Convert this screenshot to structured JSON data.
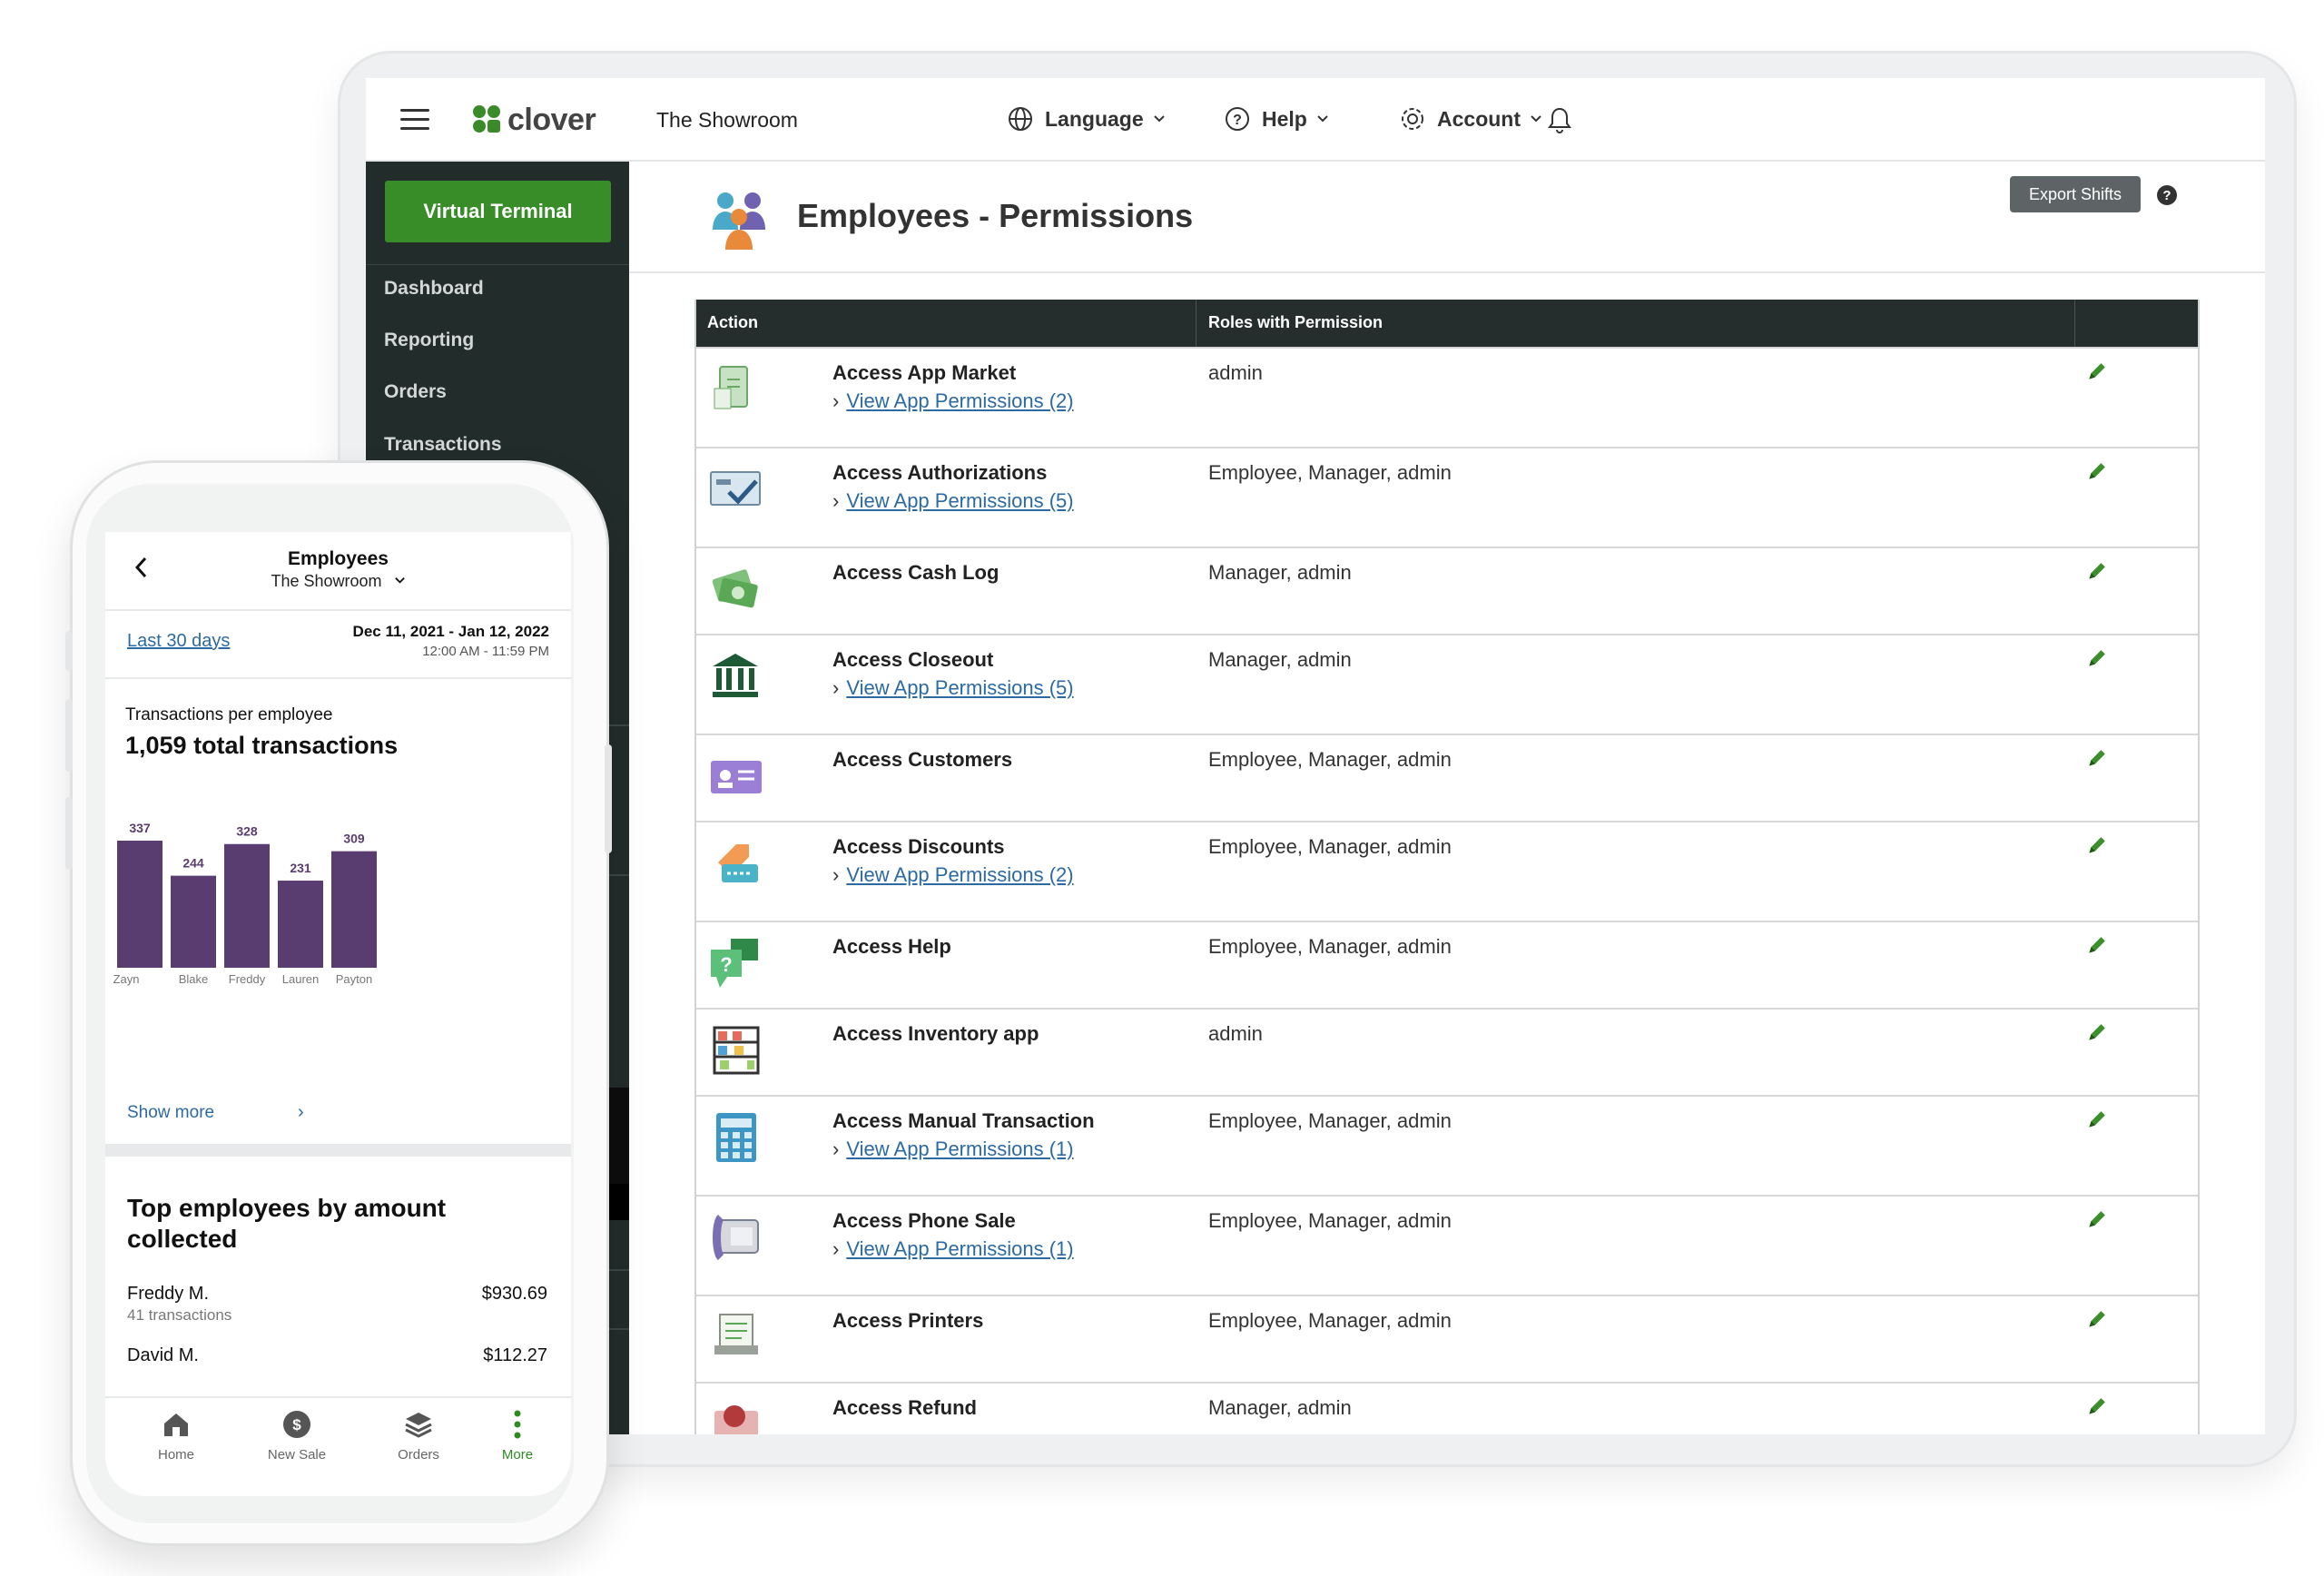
{
  "topbar": {
    "logo_text": "clover",
    "merchant": "The Showroom",
    "language": "Language",
    "help": "Help",
    "account": "Account"
  },
  "sidebar": {
    "virtual_terminal": "Virtual Terminal",
    "items": [
      "Dashboard",
      "Reporting",
      "Orders",
      "Transactions"
    ]
  },
  "page": {
    "title": "Employees - Permissions",
    "export_label": "Export Shifts",
    "help_glyph": "?"
  },
  "table": {
    "col_action": "Action",
    "col_roles": "Roles with Permission",
    "rows": [
      {
        "action": "Access App Market",
        "link": "View App Permissions (2)",
        "roles": "admin",
        "icon": "app-market-icon"
      },
      {
        "action": "Access Authorizations",
        "link": "View App Permissions (5)",
        "roles": "Employee, Manager, admin",
        "icon": "authorizations-icon"
      },
      {
        "action": "Access Cash Log",
        "link": "",
        "roles": "Manager, admin",
        "icon": "cash-icon"
      },
      {
        "action": "Access Closeout",
        "link": "View App Permissions (5)",
        "roles": "Manager, admin",
        "icon": "bank-icon"
      },
      {
        "action": "Access Customers",
        "link": "",
        "roles": "Employee, Manager, admin",
        "icon": "customer-card-icon"
      },
      {
        "action": "Access Discounts",
        "link": "View App Permissions (2)",
        "roles": "Employee, Manager, admin",
        "icon": "discount-icon"
      },
      {
        "action": "Access Help",
        "link": "",
        "roles": "Employee, Manager, admin",
        "icon": "help-chat-icon"
      },
      {
        "action": "Access Inventory app",
        "link": "",
        "roles": "admin",
        "icon": "inventory-shelf-icon"
      },
      {
        "action": "Access Manual Transaction",
        "link": "View App Permissions (1)",
        "roles": "Employee, Manager, admin",
        "icon": "calculator-icon"
      },
      {
        "action": "Access Phone Sale",
        "link": "View App Permissions (1)",
        "roles": "Employee, Manager, admin",
        "icon": "phone-icon"
      },
      {
        "action": "Access Printers",
        "link": "",
        "roles": "Employee, Manager, admin",
        "icon": "printer-icon"
      },
      {
        "action": "Access Refund",
        "link": "",
        "roles": "Manager, admin",
        "icon": "refund-icon"
      }
    ]
  },
  "phone": {
    "title": "Employees",
    "subtitle": "The Showroom",
    "range_label": "Last 30 days",
    "date_range": "Dec 11, 2021 - Jan 12, 2022",
    "time_range": "12:00 AM - 11:59 PM",
    "chart_title": "Transactions per employee",
    "chart_total": "1,059 total transactions",
    "show_more": "Show more",
    "top_title": "Top employees by amount collected",
    "employees": [
      {
        "name": "Freddy M.",
        "sub": "41 transactions",
        "amount": "$930.69"
      },
      {
        "name": "David M.",
        "sub": "",
        "amount": "$112.27"
      }
    ],
    "nav": [
      "Home",
      "New Sale",
      "Orders",
      "More"
    ]
  },
  "colors": {
    "accent_green": "#398d28",
    "sidebar_bg": "#222c2b",
    "bar_purple": "#5a3d70",
    "link_blue": "#2c6aa3"
  },
  "chart_data": {
    "type": "bar",
    "title": "Transactions per employee",
    "categories": [
      "Zayn",
      "Blake",
      "Freddy",
      "Lauren",
      "Payton"
    ],
    "values": [
      337,
      244,
      328,
      231,
      309
    ],
    "ylim": [
      0,
      337
    ]
  }
}
